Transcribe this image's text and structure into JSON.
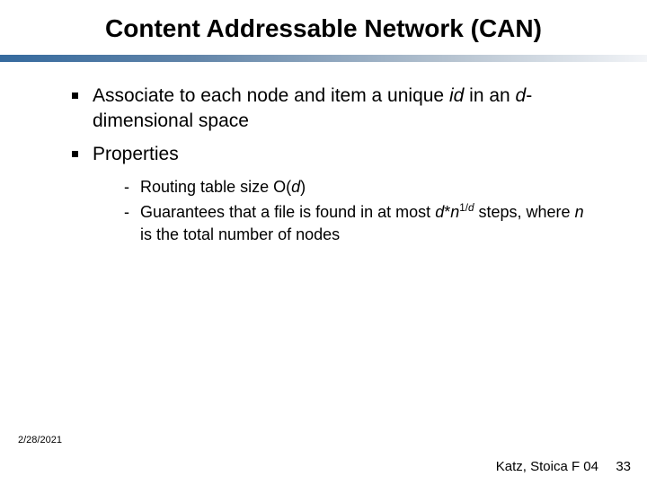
{
  "title": "Content Addressable Network (CAN)",
  "bullets": [
    {
      "pre": "Associate to each node and item a unique ",
      "id_word": "id",
      "mid": " in an ",
      "d_word": "d",
      "post": "-dimensional space"
    },
    {
      "plain": "Properties"
    }
  ],
  "sub_bullets": [
    {
      "pre": "Routing table size O(",
      "d": "d",
      "post": ")"
    },
    {
      "pre": "Guarantees that a file is found in at most ",
      "d": "d",
      "star": "*",
      "n": "n",
      "exp_1": "1/",
      "exp_d": "d",
      "post1": " steps, where ",
      "n2": "n",
      "post2": " is the total number of nodes"
    }
  ],
  "footer": {
    "date": "2/28/2021",
    "credit": "Katz, Stoica F 04",
    "page": "33"
  }
}
